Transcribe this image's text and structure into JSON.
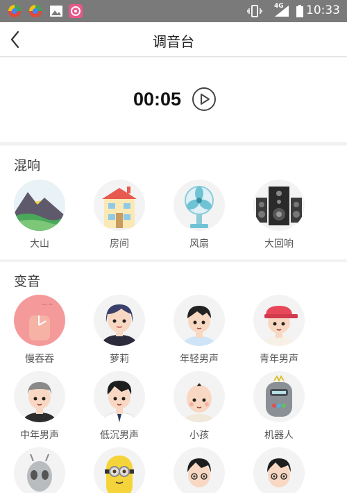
{
  "status_bar": {
    "time": "10:33",
    "network": "4G"
  },
  "header": {
    "title": "调音台"
  },
  "player": {
    "time": "00:05"
  },
  "reverb": {
    "title": "混响",
    "items": [
      {
        "label": "大山",
        "icon": "mountain-icon"
      },
      {
        "label": "房间",
        "icon": "house-icon"
      },
      {
        "label": "风扇",
        "icon": "fan-icon"
      },
      {
        "label": "大回响",
        "icon": "speakers-icon"
      }
    ]
  },
  "voice": {
    "title": "变音",
    "items": [
      {
        "label": "慢吞吞",
        "icon": "slow-hand-icon"
      },
      {
        "label": "萝莉",
        "icon": "girl-avatar-icon"
      },
      {
        "label": "年轻男声",
        "icon": "young-man-avatar-icon"
      },
      {
        "label": "青年男声",
        "icon": "cap-boy-avatar-icon"
      },
      {
        "label": "中年男声",
        "icon": "middle-aged-man-avatar-icon"
      },
      {
        "label": "低沉男声",
        "icon": "deep-voice-man-avatar-icon"
      },
      {
        "label": "小孩",
        "icon": "child-avatar-icon"
      },
      {
        "label": "机器人",
        "icon": "robot-avatar-icon"
      },
      {
        "label": "",
        "icon": "alien-avatar-icon"
      },
      {
        "label": "",
        "icon": "minion-avatar-icon"
      },
      {
        "label": "",
        "icon": "dizzy-boy-avatar-icon"
      },
      {
        "label": "",
        "icon": "dizzy-boy-2-avatar-icon"
      }
    ]
  },
  "colors": {
    "status_bar": "#7a7a7a",
    "background": "#f2f2f2",
    "panel": "#ffffff",
    "slow_circle": "#f49a9a"
  }
}
